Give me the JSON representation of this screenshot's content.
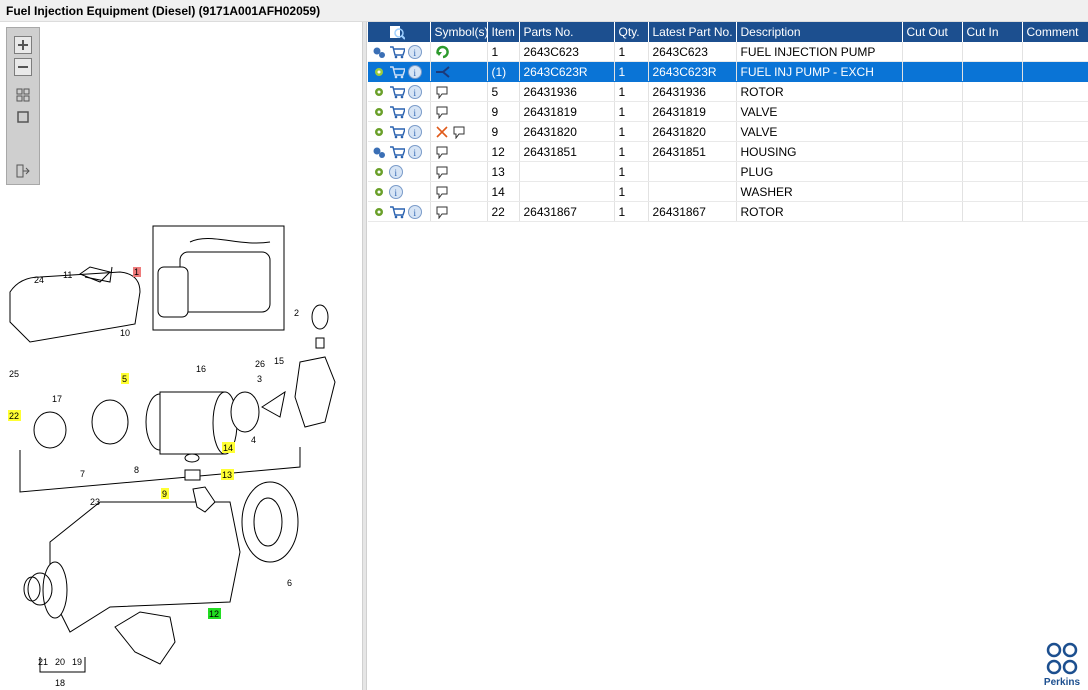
{
  "window": {
    "title": "Fuel Injection Equipment (Diesel) (9171A001AFH02059)"
  },
  "toolbar": {
    "zoom_in_icon": "plus-icon",
    "zoom_out_icon": "minus-icon",
    "fit_icon": "grid-icon",
    "actual_size_icon": "square-icon",
    "export_icon": "export-icon"
  },
  "diagram": {
    "callouts": [
      "1",
      "2",
      "3",
      "4",
      "5",
      "6",
      "7",
      "8",
      "9",
      "10",
      "11",
      "12",
      "13",
      "14",
      "15",
      "16",
      "17",
      "18",
      "19",
      "20",
      "21",
      "22",
      "23",
      "24",
      "25",
      "26"
    ],
    "highlight_colors": {
      "pink": "#ef7b7b",
      "yellow": "#ffff33",
      "green": "#22dd22"
    }
  },
  "table": {
    "headers": {
      "icon_col_icon": "search-list-icon",
      "symbols": "Symbol(s)",
      "item": "Item",
      "parts_no": "Parts No.",
      "qty": "Qty.",
      "latest_part_no": "Latest Part No.",
      "description": "Description",
      "cut_out": "Cut Out",
      "cut_in": "Cut In",
      "comment": "Comment"
    },
    "rows": [
      {
        "item": "1",
        "parts_no": "2643C623",
        "qty": "1",
        "latest": "2643C623",
        "description": "FUEL INJECTION PUMP",
        "cut_out": "",
        "cut_in": "",
        "comment": ""
      },
      {
        "item": "(1)",
        "parts_no": "2643C623R",
        "qty": "1",
        "latest": "2643C623R",
        "description": "FUEL INJ PUMP - EXCH",
        "cut_out": "",
        "cut_in": "",
        "comment": ""
      },
      {
        "item": "5",
        "parts_no": "26431936",
        "qty": "1",
        "latest": "26431936",
        "description": "ROTOR",
        "cut_out": "",
        "cut_in": "",
        "comment": ""
      },
      {
        "item": "9",
        "parts_no": "26431819",
        "qty": "1",
        "latest": "26431819",
        "description": "VALVE",
        "cut_out": "",
        "cut_in": "",
        "comment": ""
      },
      {
        "item": "9",
        "parts_no": "26431820",
        "qty": "1",
        "latest": "26431820",
        "description": "VALVE",
        "cut_out": "",
        "cut_in": "",
        "comment": ""
      },
      {
        "item": "12",
        "parts_no": "26431851",
        "qty": "1",
        "latest": "26431851",
        "description": "HOUSING",
        "cut_out": "",
        "cut_in": "",
        "comment": ""
      },
      {
        "item": "13",
        "parts_no": "",
        "qty": "1",
        "latest": "",
        "description": "PLUG",
        "cut_out": "",
        "cut_in": "",
        "comment": ""
      },
      {
        "item": "14",
        "parts_no": "",
        "qty": "1",
        "latest": "",
        "description": "WASHER",
        "cut_out": "",
        "cut_in": "",
        "comment": ""
      },
      {
        "item": "22",
        "parts_no": "26431867",
        "qty": "1",
        "latest": "26431867",
        "description": "ROTOR",
        "cut_out": "",
        "cut_in": "",
        "comment": ""
      }
    ],
    "selected_row": 1
  },
  "logo": {
    "text": "Perkins",
    "icon": "perkins-logo-icon",
    "color": "#1c4f8f"
  },
  "colors": {
    "header_bg": "#1c4f8f",
    "selected_bg": "#0a74d6"
  }
}
